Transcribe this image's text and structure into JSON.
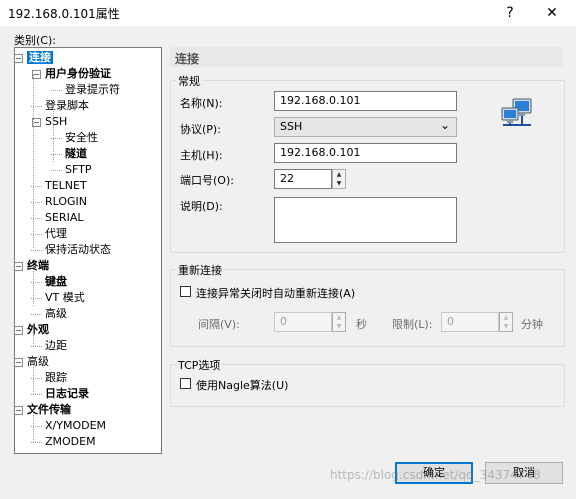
{
  "window": {
    "title": "192.168.0.101属性",
    "help_glyph": "?",
    "close_glyph": "✕"
  },
  "category_label": "类别(C):",
  "tree": [
    {
      "label": "连接",
      "bold": true,
      "selected": true,
      "toggle": "−"
    },
    {
      "label": "用户身份验证",
      "bold": true,
      "toggle": "−"
    },
    {
      "label": "登录提示符",
      "bold": false
    },
    {
      "label": "登录脚本",
      "bold": false
    },
    {
      "label": "SSH",
      "bold": false,
      "toggle": "−"
    },
    {
      "label": "安全性",
      "bold": false
    },
    {
      "label": "隧道",
      "bold": true
    },
    {
      "label": "SFTP",
      "bold": false
    },
    {
      "label": "TELNET",
      "bold": false
    },
    {
      "label": "RLOGIN",
      "bold": false
    },
    {
      "label": "SERIAL",
      "bold": false
    },
    {
      "label": "代理",
      "bold": false
    },
    {
      "label": "保持活动状态",
      "bold": false
    },
    {
      "label": "终端",
      "bold": true,
      "toggle": "−"
    },
    {
      "label": "键盘",
      "bold": true
    },
    {
      "label": "VT 模式",
      "bold": false
    },
    {
      "label": "高级",
      "bold": false
    },
    {
      "label": "外观",
      "bold": true,
      "toggle": "−"
    },
    {
      "label": "边距",
      "bold": false
    },
    {
      "label": "高级",
      "bold": false,
      "toggle": "−"
    },
    {
      "label": "跟踪",
      "bold": false
    },
    {
      "label": "日志记录",
      "bold": true
    },
    {
      "label": "文件传输",
      "bold": true,
      "toggle": "−"
    },
    {
      "label": "X/YMODEM",
      "bold": false
    },
    {
      "label": "ZMODEM",
      "bold": false
    }
  ],
  "panel": {
    "header": "连接",
    "general": {
      "group_label": "常规",
      "name_label": "名称(N):",
      "name_value": "192.168.0.101",
      "protocol_label": "协议(P):",
      "protocol_value": "SSH",
      "host_label": "主机(H):",
      "host_value": "192.168.0.101",
      "port_label": "端口号(O):",
      "port_value": "22",
      "desc_label": "说明(D):",
      "desc_value": ""
    },
    "reconnect": {
      "group_label": "重新连接",
      "checkbox_label": "连接异常关闭时自动重新连接(A)",
      "checked": false,
      "interval_label": "间隔(V):",
      "interval_value": "0",
      "interval_unit": "秒",
      "limit_label": "限制(L):",
      "limit_value": "0",
      "limit_unit": "分钟"
    },
    "tcp": {
      "group_label": "TCP选项",
      "checkbox_label": "使用Nagle算法(U)",
      "checked": false
    }
  },
  "buttons": {
    "ok": "确定",
    "cancel": "取消"
  },
  "watermark": "https://blog.csdn.net/qq_34374748",
  "icons": {
    "connection": "network-computers-icon",
    "spin_up": "▲",
    "spin_down": "▼",
    "combo_arrow": "⌄"
  }
}
